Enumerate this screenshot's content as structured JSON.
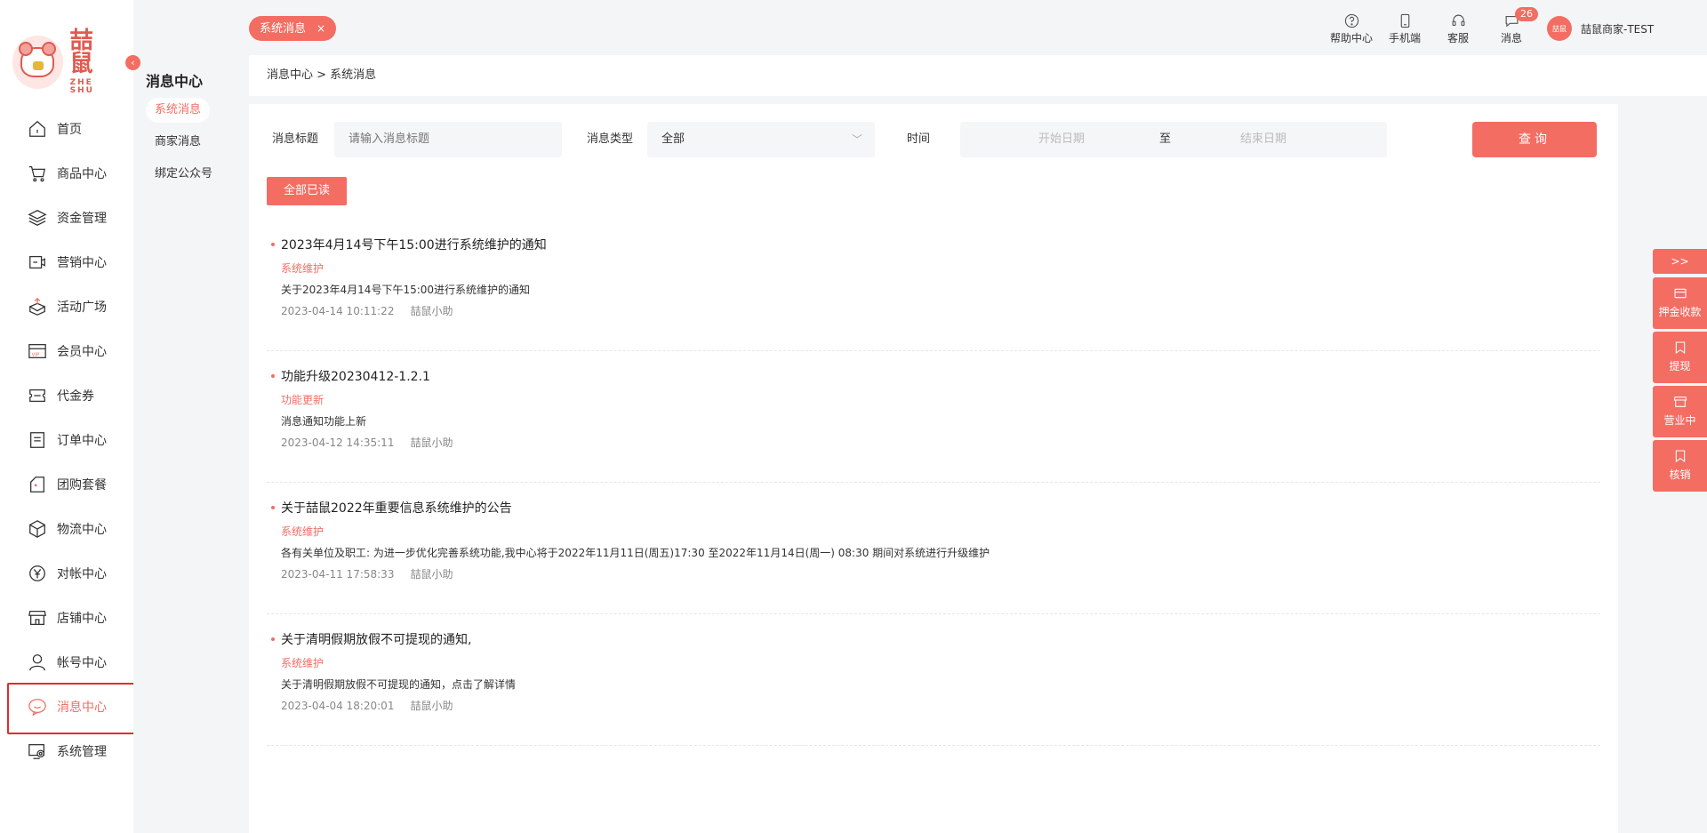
{
  "logo": {
    "cn": "喆鼠",
    "en": "ZHE SHU"
  },
  "nav": [
    {
      "label": "首页",
      "icon": "home-icon"
    },
    {
      "label": "商品中心",
      "icon": "cart-icon"
    },
    {
      "label": "资金管理",
      "icon": "layers-icon"
    },
    {
      "label": "营销中心",
      "icon": "marketing-icon"
    },
    {
      "label": "活动广场",
      "icon": "box-upload-icon"
    },
    {
      "label": "会员中心",
      "icon": "vip-card-icon"
    },
    {
      "label": "代金券",
      "icon": "coupon-icon"
    },
    {
      "label": "订单中心",
      "icon": "order-icon"
    },
    {
      "label": "团购套餐",
      "icon": "group-buy-icon"
    },
    {
      "label": "物流中心",
      "icon": "package-icon"
    },
    {
      "label": "对帐中心",
      "icon": "yen-icon"
    },
    {
      "label": "店铺中心",
      "icon": "store-icon"
    },
    {
      "label": "帐号中心",
      "icon": "user-icon"
    },
    {
      "label": "消息中心",
      "icon": "message-icon"
    },
    {
      "label": "系统管理",
      "icon": "system-settings-icon"
    }
  ],
  "sub": {
    "title": "消息中心",
    "items": [
      "系统消息",
      "商家消息",
      "绑定公众号"
    ]
  },
  "header": {
    "tag": "系统消息",
    "tag_close": "×",
    "help": "帮助中心",
    "mobile": "手机端",
    "service": "客服",
    "messages": "消息",
    "message_count": "26",
    "avatar_text": "喆鼠",
    "username": "喆鼠商家-TEST"
  },
  "breadcrumb": "消息中心 > 系统消息",
  "filters": {
    "title_label": "消息标题",
    "title_placeholder": "请输入消息标题",
    "type_label": "消息类型",
    "type_value": "全部",
    "time_label": "时间",
    "start_date": "开始日期",
    "range_sep": "至",
    "end_date": "结束日期",
    "query": "查询"
  },
  "read_all": "全部已读",
  "messages": [
    {
      "title": "2023年4月14号下午15:00进行系统维护的通知",
      "type": "系统维护",
      "desc": "关于2023年4月14号下午15:00进行系统维护的通知",
      "time": "2023-04-14 10:11:22",
      "author": "喆鼠小助"
    },
    {
      "title": "功能升级20230412-1.2.1",
      "type": "功能更新",
      "desc": "消息通知功能上新",
      "time": "2023-04-12 14:35:11",
      "author": "喆鼠小助"
    },
    {
      "title": "关于喆鼠2022年重要信息系统维护的公告",
      "type": "系统维护",
      "desc": "各有关单位及职工: 为进一步优化完善系统功能,我中心将于2022年11月11日(周五)17:30 至2022年11月14日(周一) 08:30 期间对系统进行升级维护",
      "time": "2023-04-11 17:58:33",
      "author": "喆鼠小助"
    },
    {
      "title": "关于清明假期放假不可提现的通知,",
      "type": "系统维护",
      "desc": "关于清明假期放假不可提现的通知，点击了解详情",
      "time": "2023-04-04 18:20:01",
      "author": "喆鼠小助"
    }
  ],
  "right_tools": {
    "toggle": ">>",
    "items": [
      "押金收款",
      "提现",
      "营业中",
      "核销"
    ]
  },
  "colors": {
    "accent": "#f36d63",
    "highlight_border": "#e12c2c"
  }
}
